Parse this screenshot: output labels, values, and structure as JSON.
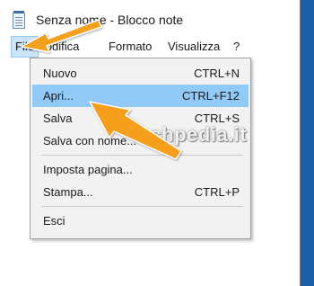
{
  "window": {
    "title": "Senza nome - Blocco note",
    "icon": "notepad-icon"
  },
  "menubar": {
    "items": [
      "File",
      "Modifica",
      "Formato",
      "Visualizza",
      "?"
    ],
    "active": "File"
  },
  "file_menu": {
    "items": [
      {
        "label": "Nuovo",
        "shortcut": "CTRL+N"
      },
      {
        "label": "Apri...",
        "shortcut": "CTRL+F12",
        "highlighted": true
      },
      {
        "label": "Salva",
        "shortcut": "CTRL+S"
      },
      {
        "label": "Salva con nome...",
        "shortcut": ""
      },
      {
        "label": "Imposta pagina...",
        "shortcut": ""
      },
      {
        "label": "Stampa...",
        "shortcut": "CTRL+P"
      },
      {
        "label": "Esci",
        "shortcut": ""
      }
    ]
  },
  "watermark": "techpedia.it",
  "colors": {
    "highlight": "#91c9f7",
    "menu_active": "#cce4f7",
    "arrow": "#f5a01a",
    "desktop": "#1a5fa8"
  }
}
